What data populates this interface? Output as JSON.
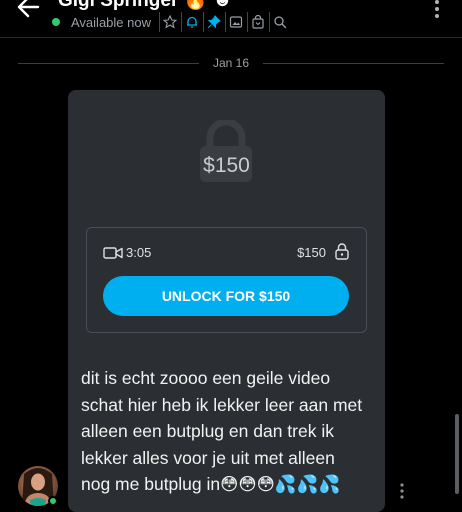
{
  "header": {
    "title": "Gigi Springer 🔥 ☻",
    "status": "Available now",
    "icons": [
      "star-icon",
      "bell-icon",
      "pin-icon",
      "image-icon",
      "shopping-bag-icon",
      "search-icon"
    ]
  },
  "date_separator": "Jan 16",
  "ppv": {
    "preview_price": "$150",
    "duration": "3:05",
    "price": "$150",
    "unlock_label": "UNLOCK FOR $150"
  },
  "message": {
    "lines": [
      "dit is echt zoooo een geile video",
      "schat hier heb ik lekker leer aan met",
      "alleen een butplug en dan trek ik",
      "lekker alles voor je uit met alleen",
      "nog me butplug in😳😳😳💦💦💦"
    ]
  },
  "colors": {
    "accent": "#00aff0",
    "online": "#2ecc71",
    "bubble": "#2b2e33",
    "background": "#000000"
  }
}
